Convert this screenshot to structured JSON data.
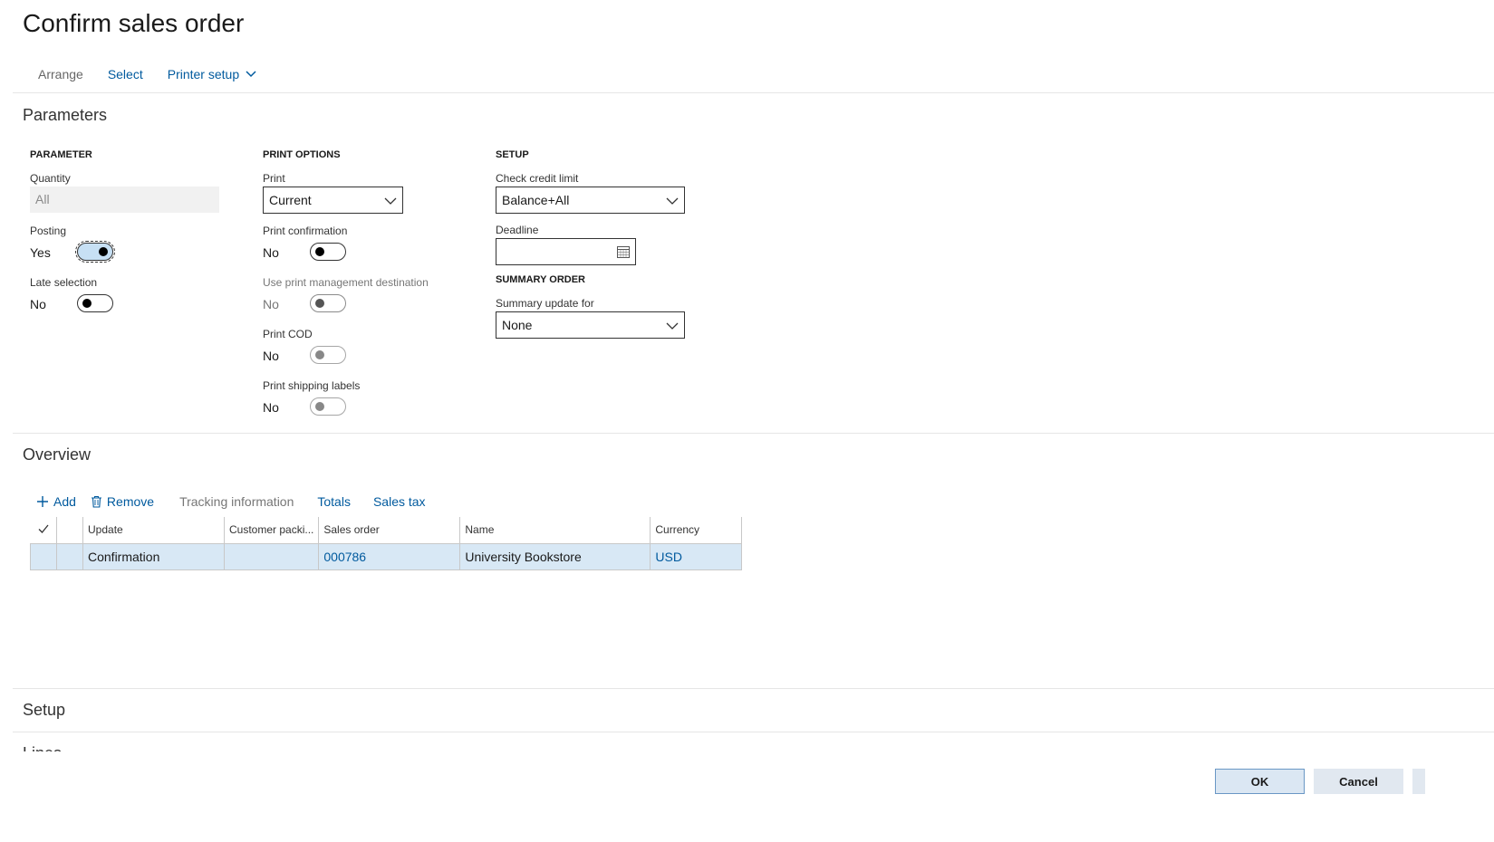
{
  "page_title": "Confirm sales order",
  "actions": {
    "arrange": "Arrange",
    "select": "Select",
    "printer_setup": "Printer setup"
  },
  "parameters": {
    "section_title": "Parameters",
    "parameter_group": {
      "header": "PARAMETER",
      "quantity_label": "Quantity",
      "quantity_value": "All",
      "posting_label": "Posting",
      "posting_value": "Yes",
      "late_selection_label": "Late selection",
      "late_selection_value": "No"
    },
    "print_options": {
      "header": "PRINT OPTIONS",
      "print_label": "Print",
      "print_value": "Current",
      "print_confirmation_label": "Print confirmation",
      "print_confirmation_value": "No",
      "use_print_mgmt_label": "Use print management destination",
      "use_print_mgmt_value": "No",
      "print_cod_label": "Print COD",
      "print_cod_value": "No",
      "print_shipping_labels_label": "Print shipping labels",
      "print_shipping_labels_value": "No"
    },
    "setup": {
      "header": "SETUP",
      "check_credit_limit_label": "Check credit limit",
      "check_credit_limit_value": "Balance+All",
      "deadline_label": "Deadline",
      "deadline_value": ""
    },
    "summary_order": {
      "header": "SUMMARY ORDER",
      "summary_update_label": "Summary update for",
      "summary_update_value": "None"
    }
  },
  "overview": {
    "section_title": "Overview",
    "toolbar": {
      "add": "Add",
      "remove": "Remove",
      "tracking_information": "Tracking information",
      "totals": "Totals",
      "sales_tax": "Sales tax"
    },
    "columns": {
      "update": "Update",
      "customer_packing": "Customer packi...",
      "sales_order": "Sales order",
      "name": "Name",
      "currency": "Currency"
    },
    "rows": [
      {
        "update": "Confirmation",
        "customer_packing": "",
        "sales_order": "000786",
        "name": "University Bookstore",
        "currency": "USD"
      }
    ]
  },
  "setup_section_title": "Setup",
  "lines_section_title": "Lines",
  "footer": {
    "ok": "OK",
    "cancel": "Cancel"
  }
}
